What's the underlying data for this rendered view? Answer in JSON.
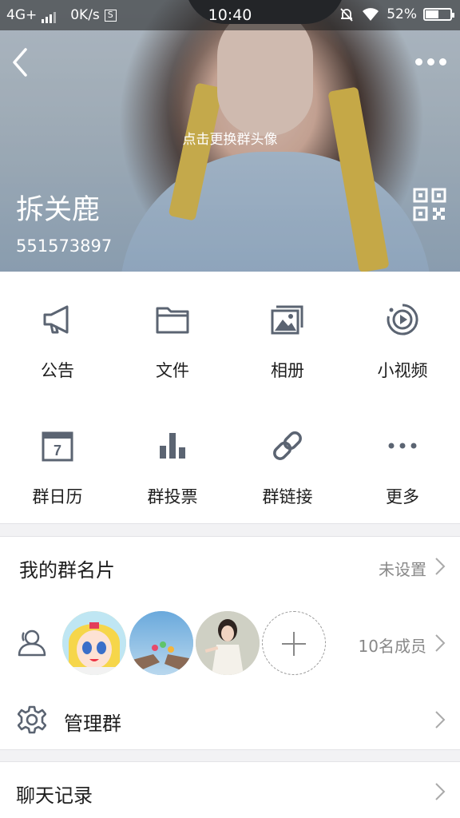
{
  "status_bar": {
    "network": "4G+",
    "speed": "0K/s",
    "speed_icon_text": "S",
    "time": "10:40",
    "battery": "52%",
    "battery_level": 0.52
  },
  "header": {
    "change_avatar_hint": "点击更换群头像",
    "group_name": "拆关鹿",
    "group_id": "551573897"
  },
  "features": [
    {
      "label": "公告",
      "icon": "megaphone-icon"
    },
    {
      "label": "文件",
      "icon": "folder-icon"
    },
    {
      "label": "相册",
      "icon": "photo-album-icon"
    },
    {
      "label": "小视频",
      "icon": "video-icon"
    },
    {
      "label": "群日历",
      "icon": "calendar-icon",
      "icon_text": "7"
    },
    {
      "label": "群投票",
      "icon": "bar-chart-icon"
    },
    {
      "label": "群链接",
      "icon": "link-icon"
    },
    {
      "label": "更多",
      "icon": "more-dots-icon"
    }
  ],
  "card_row": {
    "title": "我的群名片",
    "value": "未设置"
  },
  "members_row": {
    "count": "10名成员"
  },
  "manage_row": {
    "title": "管理群"
  },
  "chat_row": {
    "title": "聊天记录"
  },
  "colors": {
    "icon": "#5b6472",
    "text": "#1e1e1e",
    "secondary": "#888888",
    "separator": "#f2f2f4"
  }
}
